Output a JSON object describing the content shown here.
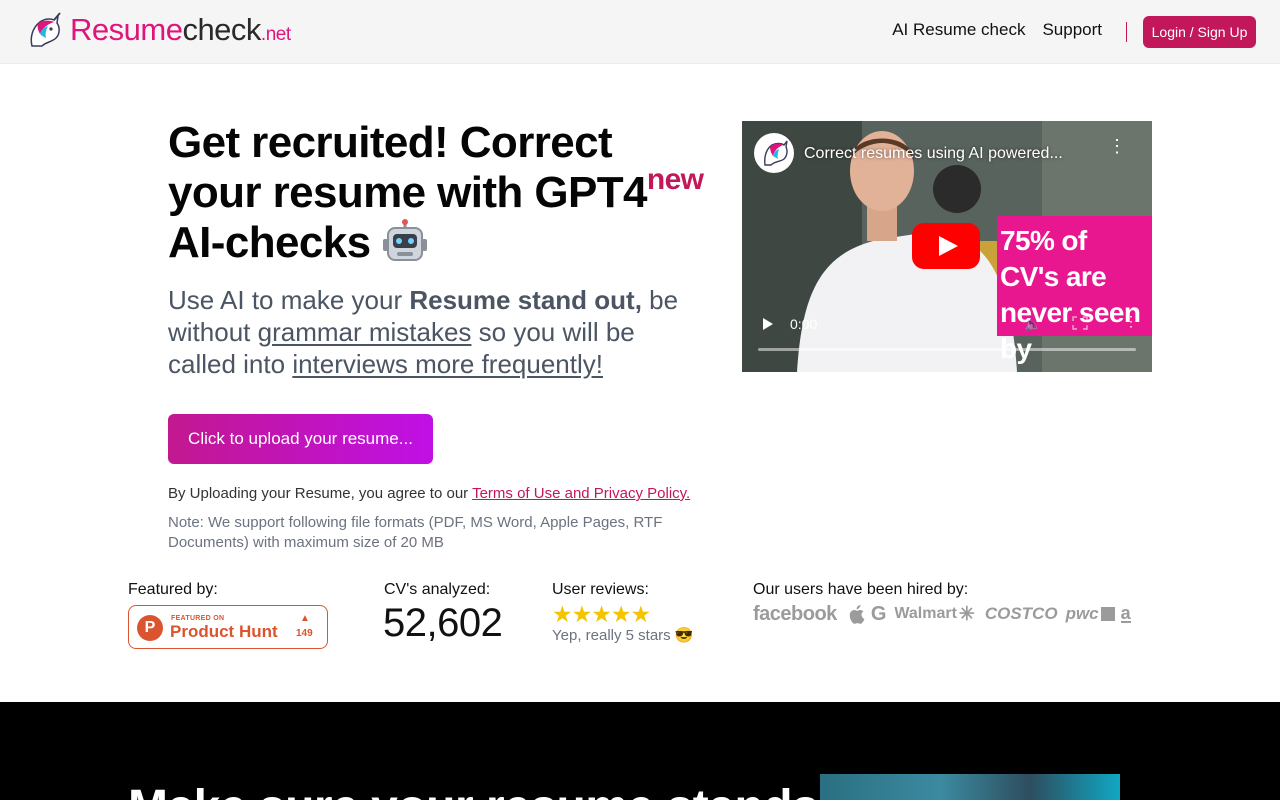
{
  "brand": {
    "part1": "Resume",
    "part2": "check",
    "part3": ".net",
    "accent_color": "#c2185b"
  },
  "nav": {
    "items": [
      "AI Resume check",
      "Support"
    ],
    "login_label": "Login / Sign Up"
  },
  "hero": {
    "title_part1": "Get recruited! Correct your resume with GPT4",
    "title_sup": "new",
    "title_part2": " AI-checks",
    "title_emoji": "robot-emoji",
    "sub_1": "Use AI to make your ",
    "sub_bold": "Resume stand out,",
    "sub_2": " be without ",
    "sub_link1": "grammar mistakes",
    "sub_3": " so you will be called into ",
    "sub_link2": "interviews more frequently!",
    "upload_label": "Click to upload your resume...",
    "agree_text": "By Uploading your Resume, you agree to our ",
    "agree_link": "Terms of Use and Privacy Policy.",
    "note": "Note: We support following file formats (PDF, MS Word, Apple Pages, RTF Documents) with maximum size of 20 MB"
  },
  "video": {
    "title": "Correct resumes using AI powered...",
    "overlay_text": "75% of CV's are never seen by",
    "time": "0:00"
  },
  "stats": {
    "featured_label": "Featured by:",
    "ph_small": "FEATURED ON",
    "ph_name": "Product Hunt",
    "ph_count": "149",
    "cv_label": "CV's analyzed:",
    "cv_count": "52,602",
    "reviews_label": "User reviews:",
    "stars": "★★★★★",
    "rating": 5,
    "reviews_text": "Yep, really 5 stars 😎",
    "hired_label": "Our users have been hired by:",
    "companies": [
      "facebook",
      "Apple",
      "Google",
      "Walmart",
      "Costco",
      "pwc",
      "Amazon"
    ]
  },
  "dark_section": {
    "heading": "Make sure your resume stands"
  }
}
